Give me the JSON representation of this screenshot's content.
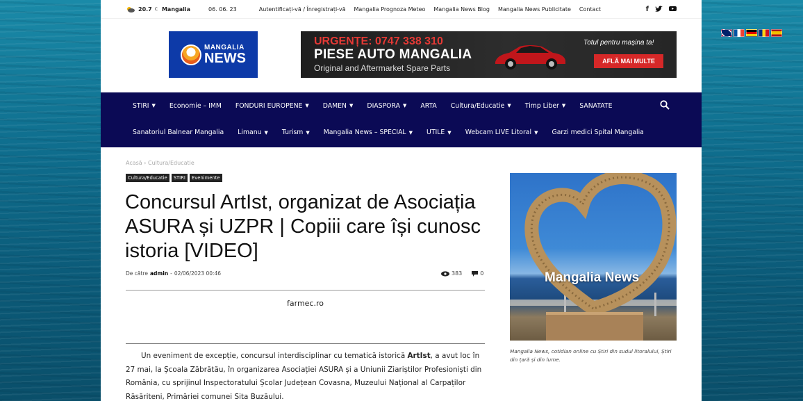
{
  "topbar": {
    "temperature": "20.7",
    "temp_unit": "C",
    "city": "Mangalia",
    "date": "06. 06. 23",
    "links": [
      "Autentificați-vă / Înregistrați-vă",
      "Mangalia Prognoza Meteo",
      "Mangalia News Blog",
      "Mangalia News Publicitate",
      "Contact"
    ],
    "social_icons": [
      "facebook-icon",
      "twitter-icon",
      "youtube-icon"
    ]
  },
  "logo": {
    "line1": "MANGALIA",
    "line2": "NEWS"
  },
  "banner": {
    "urgent": "URGENȚE: 0747 338 310",
    "title": "PIESE AUTO MANGALIA",
    "subtitle": "Original and Aftermarket Spare Parts",
    "tagline": "Totul pentru mașina ta!",
    "cta": "AFLĂ MAI MULTE"
  },
  "nav": {
    "row1": [
      {
        "label": "STIRI",
        "dropdown": true
      },
      {
        "label": "Economie – IMM",
        "dropdown": false
      },
      {
        "label": "FONDURI EUROPENE",
        "dropdown": true
      },
      {
        "label": "DAMEN",
        "dropdown": true
      },
      {
        "label": "DIASPORA",
        "dropdown": true
      },
      {
        "label": "ARTA",
        "dropdown": false
      },
      {
        "label": "Cultura/Educatie",
        "dropdown": true
      },
      {
        "label": "Timp Liber",
        "dropdown": true
      },
      {
        "label": "SANATATE",
        "dropdown": false
      }
    ],
    "row2": [
      {
        "label": "Sanatoriul Balnear Mangalia",
        "dropdown": false
      },
      {
        "label": "Limanu",
        "dropdown": true
      },
      {
        "label": "Turism",
        "dropdown": true
      },
      {
        "label": "Mangalia News – SPECIAL",
        "dropdown": true
      },
      {
        "label": "UTILE",
        "dropdown": true
      },
      {
        "label": "Webcam LIVE Litoral",
        "dropdown": true
      },
      {
        "label": "Garzi medici Spital Mangalia",
        "dropdown": false
      }
    ]
  },
  "breadcrumb": {
    "home": "Acasă",
    "sep": "›",
    "current": "Cultura/Educatie"
  },
  "categories": [
    "Cultura/Educatie",
    "STIRI",
    "Evenimente"
  ],
  "article": {
    "title": "Concursul ArtIst, organizat de Asociația ASURA și UZPR | Copiii care își cunosc istoria [VIDEO]",
    "by": "De către",
    "author": "admin",
    "dash": "-",
    "datetime": "02/06/2023 00:46",
    "views": "383",
    "comments": "0",
    "sponsor": "farmec.ro",
    "body_pre": "Un eveniment de excepție, concursul interdisciplinar cu tematică istorică ",
    "body_bold": "ArtIst",
    "body_post": ", a avut loc în 27 mai, la Școala Zăbrătău, în organizarea Asociației ASURA și a Uniunii Ziariștilor Profesioniști din România, cu sprijinul Inspectoratului Școlar Județean Covasna, Muzeului Național al Carpaților Răsăriteni, Primăriei comunei Sita Buzăului."
  },
  "sidebar": {
    "image_text": "Mangalia News",
    "caption": "Mangalia News, cotidian online cu Știri din sudul litoralului, Știri din țară și din lume."
  }
}
